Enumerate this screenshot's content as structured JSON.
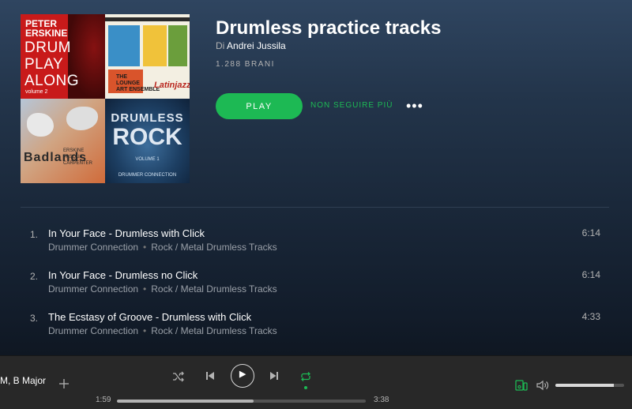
{
  "playlist": {
    "title": "Drumless practice tracks",
    "by_prefix": "Di",
    "owner": "Andrei Jussila",
    "track_count": "1.288 BRANI",
    "play_label": "PLAY",
    "follow_label": "NON SEGUIRE PIÙ",
    "more_label": "•••"
  },
  "cover": {
    "tile1": {
      "artist": "PETER\nERSKINE",
      "title": "DRUM\nPLAY\nALONG",
      "volume": "volume 2"
    },
    "tile2": {
      "band": "THE\nLOUNGE\nART ENSEMBLE",
      "label": "Latinjazz"
    },
    "tile3": {
      "title": "Badlands",
      "credits": "ERSKINE\nPASQUA\nCARPENTER"
    },
    "tile4": {
      "line1": "DRUMLESS",
      "line2": "ROCK",
      "volume": "VOLUME 1",
      "brand": "DRUMMER CONNECTION"
    }
  },
  "tracks": [
    {
      "num": "1.",
      "name": "In Your Face - Drumless with Click",
      "artist": "Drummer Connection",
      "album": "Rock / Metal Drumless Tracks",
      "duration": "6:14"
    },
    {
      "num": "2.",
      "name": "In Your Face - Drumless no Click",
      "artist": "Drummer Connection",
      "album": "Rock / Metal Drumless Tracks",
      "duration": "6:14"
    },
    {
      "num": "3.",
      "name": "The Ecstasy of Groove - Drumless with Click",
      "artist": "Drummer Connection",
      "album": "Rock / Metal Drumless Tracks",
      "duration": "4:33"
    }
  ],
  "player": {
    "now_playing": "M, B Major",
    "current_time": "1:59",
    "total_time": "3:38",
    "progress_fraction": 0.55,
    "volume_fraction": 0.85,
    "repeat_active": true,
    "accent_color": "#1db954"
  }
}
